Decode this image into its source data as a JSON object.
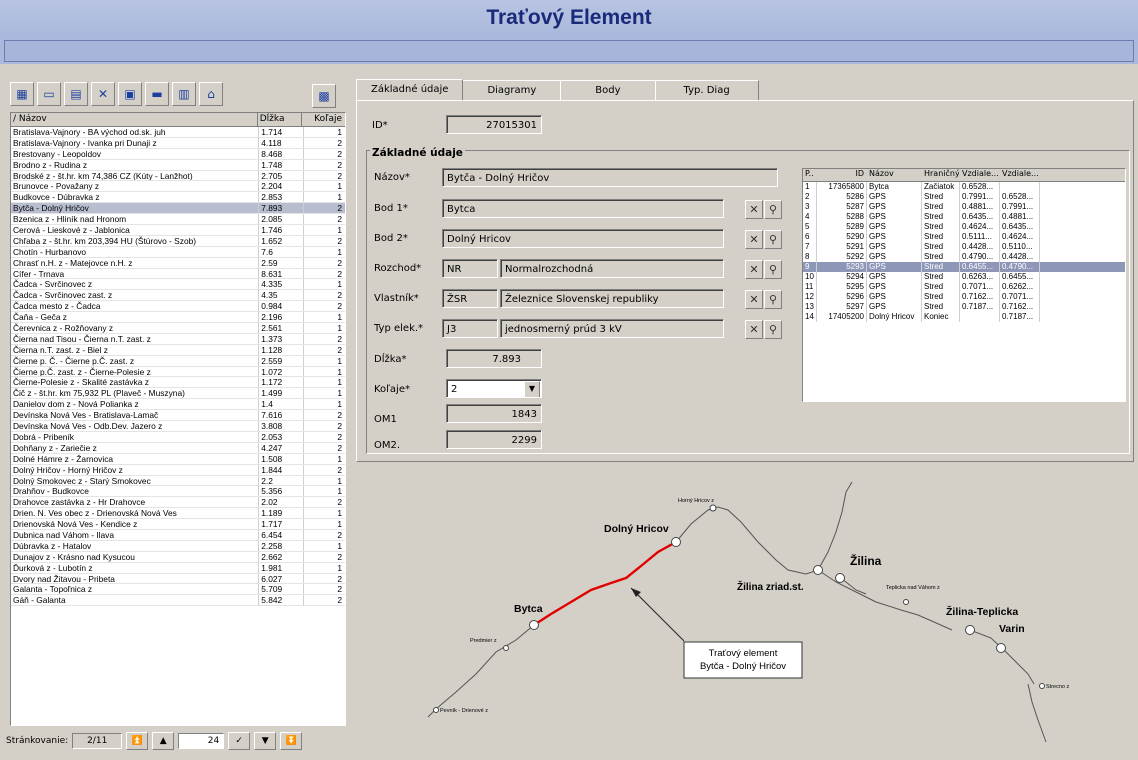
{
  "window_title": "Traťový Element",
  "list": {
    "headers": {
      "name": "/ Názov",
      "length": "Dĺžka",
      "tracks": "Koľaje"
    },
    "rows": [
      [
        "Bratislava-Vajnory - BA východ od.sk. juh",
        "1.714",
        "1"
      ],
      [
        "Bratislava-Vajnory - Ivanka pri Dunaji z",
        "4.118",
        "2"
      ],
      [
        "Brestovany - Leopoldov",
        "8.468",
        "2"
      ],
      [
        "Brodno z - Rudina z",
        "1.748",
        "2"
      ],
      [
        "Brodské z - št.hr. km 74,386 CZ (Kúty - Lanžhot)",
        "2.705",
        "2"
      ],
      [
        "Brunovce - Považany z",
        "2.204",
        "1"
      ],
      [
        "Budkovce - Dúbravka z",
        "2.853",
        "1"
      ],
      [
        "Bytča - Dolný Hričov",
        "7.893",
        "2"
      ],
      [
        "Bzenica z - Hliník nad Hronom",
        "2.085",
        "2"
      ],
      [
        "Cerová - Lieskové z - Jablonica",
        "1.746",
        "1"
      ],
      [
        "Chľaba z - št.hr. km 203,394 HU (Štúrovo - Szob)",
        "1.652",
        "2"
      ],
      [
        "Chotín - Hurbanovo",
        "7.6",
        "1"
      ],
      [
        "Chrasť n.H. z - Matejovce n.H. z",
        "2.59",
        "2"
      ],
      [
        "Cífer - Trnava",
        "8.631",
        "2"
      ],
      [
        "Čadca - Svrčinovec z",
        "4.335",
        "1"
      ],
      [
        "Čadca - Svrčinovec zast. z",
        "4.35",
        "2"
      ],
      [
        "Čadca mesto z - Čadca",
        "0.984",
        "2"
      ],
      [
        "Čaňa - Geča z",
        "2.196",
        "1"
      ],
      [
        "Čerevnica z - Rožňovany z",
        "2.561",
        "1"
      ],
      [
        "Čierna nad Tisou - Čierna n.T. zast. z",
        "1.373",
        "2"
      ],
      [
        "Čierna n.T. zast. z - Biel z",
        "1.128",
        "2"
      ],
      [
        "Čierne p. Č. - Čierne p.Č. zast. z",
        "2.559",
        "1"
      ],
      [
        "Čierne p.Č. zast. z - Čierne-Polesie z",
        "1.072",
        "1"
      ],
      [
        "Čierne-Polesie z - Skalité zastávka z",
        "1.172",
        "1"
      ],
      [
        "Čič z - št.hr. km 75,932 PL (Plaveč - Muszyna)",
        "1.499",
        "1"
      ],
      [
        "Danielov dom z - Nová Polianka z",
        "1.4",
        "1"
      ],
      [
        "Devínska Nová Ves - Bratislava-Lamač",
        "7.616",
        "2"
      ],
      [
        "Devínska Nová Ves - Odb.Dev. Jazero z",
        "3.808",
        "2"
      ],
      [
        "Dobrá - Pribeník",
        "2.053",
        "2"
      ],
      [
        "Dohňany z - Zariečie z",
        "4.247",
        "2"
      ],
      [
        "Dolné Hámre z - Žarnovica",
        "1.508",
        "1"
      ],
      [
        "Dolný Hričov - Horný Hričov z",
        "1.844",
        "2"
      ],
      [
        "Dolný Smokovec z - Starý Smokovec",
        "2.2",
        "1"
      ],
      [
        "Drahňov - Budkovce",
        "5.356",
        "1"
      ],
      [
        "Drahovce zastávka z - Hr Drahovce",
        "2.02",
        "2"
      ],
      [
        "Drien. N. Ves obec z - Drienovská Nová Ves",
        "1.189",
        "1"
      ],
      [
        "Drienovská Nová Ves - Kendice z",
        "1.717",
        "1"
      ],
      [
        "Dubnica nad Váhom - Ilava",
        "6.454",
        "2"
      ],
      [
        "Dúbravka z - Hatalov",
        "2.258",
        "1"
      ],
      [
        "Dunajov z - Krásno nad Kysucou",
        "2.662",
        "2"
      ],
      [
        "Ďurková z - Lubotín z",
        "1.981",
        "1"
      ],
      [
        "Dvory nad Žitavou - Pribeta",
        "6.027",
        "2"
      ],
      [
        "Galanta - Topoľnica z",
        "5.709",
        "2"
      ],
      [
        "Gáň - Galanta",
        "5.842",
        "2"
      ]
    ],
    "selected_index": 7
  },
  "pager": {
    "label": "Stránkovanie:",
    "value": "2/11",
    "page_size": "24"
  },
  "tabs": [
    "Základné údaje",
    "Diagramy",
    "Body",
    "Typ. Diag"
  ],
  "form": {
    "id_label": "ID*",
    "id_value": "27015301",
    "group_title": "Základné údaje",
    "name_label": "Názov*",
    "name_value": "Bytča - Dolný Hričov",
    "bod1_label": "Bod 1*",
    "bod1_value": "Bytca",
    "bod2_label": "Bod 2*",
    "bod2_value": "Dolný Hricov",
    "rozchod_label": "Rozchod*",
    "rozchod_code": "NR",
    "rozchod_value": "Normalrozchodná",
    "vlastnik_label": "Vlastník*",
    "vlastnik_code": "ŽSR",
    "vlastnik_value": "Železnice Slovenskej republiky",
    "typ_label": "Typ elek.*",
    "typ_code": "J3",
    "typ_value": "jednosmerný prúd 3 kV",
    "dlzka_label": "Dĺžka*",
    "dlzka_value": "7.893",
    "kolaje_label": "Koľaje*",
    "kolaje_value": "2",
    "om1_label": "OM1",
    "om1_value": "1843",
    "om2_label": "OM2.",
    "om2_value": "2299"
  },
  "points": {
    "headers": [
      "P..",
      "ID",
      "Názov",
      "Hraničný",
      "Vzdiale...",
      "Vzdiale..."
    ],
    "rows": [
      [
        "1",
        "17365800",
        "Bytca",
        "Začiatok",
        "0.6528...",
        ""
      ],
      [
        "2",
        "5286",
        "GPS",
        "Stred",
        "0.7991...",
        "0.6528..."
      ],
      [
        "3",
        "5287",
        "GPS",
        "Stred",
        "0.4881...",
        "0.7991..."
      ],
      [
        "4",
        "5288",
        "GPS",
        "Stred",
        "0.6435...",
        "0.4881..."
      ],
      [
        "5",
        "5289",
        "GPS",
        "Stred",
        "0.4624...",
        "0.6435..."
      ],
      [
        "6",
        "5290",
        "GPS",
        "Stred",
        "0.5111...",
        "0.4624..."
      ],
      [
        "7",
        "5291",
        "GPS",
        "Stred",
        "0.4428...",
        "0.5110..."
      ],
      [
        "8",
        "5292",
        "GPS",
        "Stred",
        "0.4790...",
        "0.4428..."
      ],
      [
        "9",
        "5293",
        "GPS",
        "Stred",
        "0.6455...",
        "0.4790..."
      ],
      [
        "10",
        "5294",
        "GPS",
        "Stred",
        "0.6263...",
        "0.6455..."
      ],
      [
        "11",
        "5295",
        "GPS",
        "Stred",
        "0.7071...",
        "0.6262..."
      ],
      [
        "12",
        "5296",
        "GPS",
        "Stred",
        "0.7162...",
        "0.7071..."
      ],
      [
        "13",
        "5297",
        "GPS",
        "Stred",
        "0.7187...",
        "0.7162..."
      ],
      [
        "14",
        "17405200",
        "Dolný Hricov",
        "Koniec",
        "",
        "0.7187..."
      ]
    ],
    "selected_index": 8
  },
  "diagram": {
    "stations": {
      "bytca": "Bytca",
      "dolny_hricov": "Dolný Hricov",
      "horny_hricov": "Horný Hricov z",
      "zilina": "Žilina",
      "zilina_zriad": "Žilina zriad.st.",
      "teplicka_z": "Teplicka nad Váhom z",
      "zilina_teplicka": "Žilina-Teplicka",
      "varin": "Varin",
      "predmier": "Predmier z",
      "pevnik": "Pevník - Drienové z",
      "strecno": "Strecno z"
    },
    "callout_line1": "Traťový element",
    "callout_line2": "Bytča - Dolný Hričov",
    "highlight_color": "#e00000"
  }
}
